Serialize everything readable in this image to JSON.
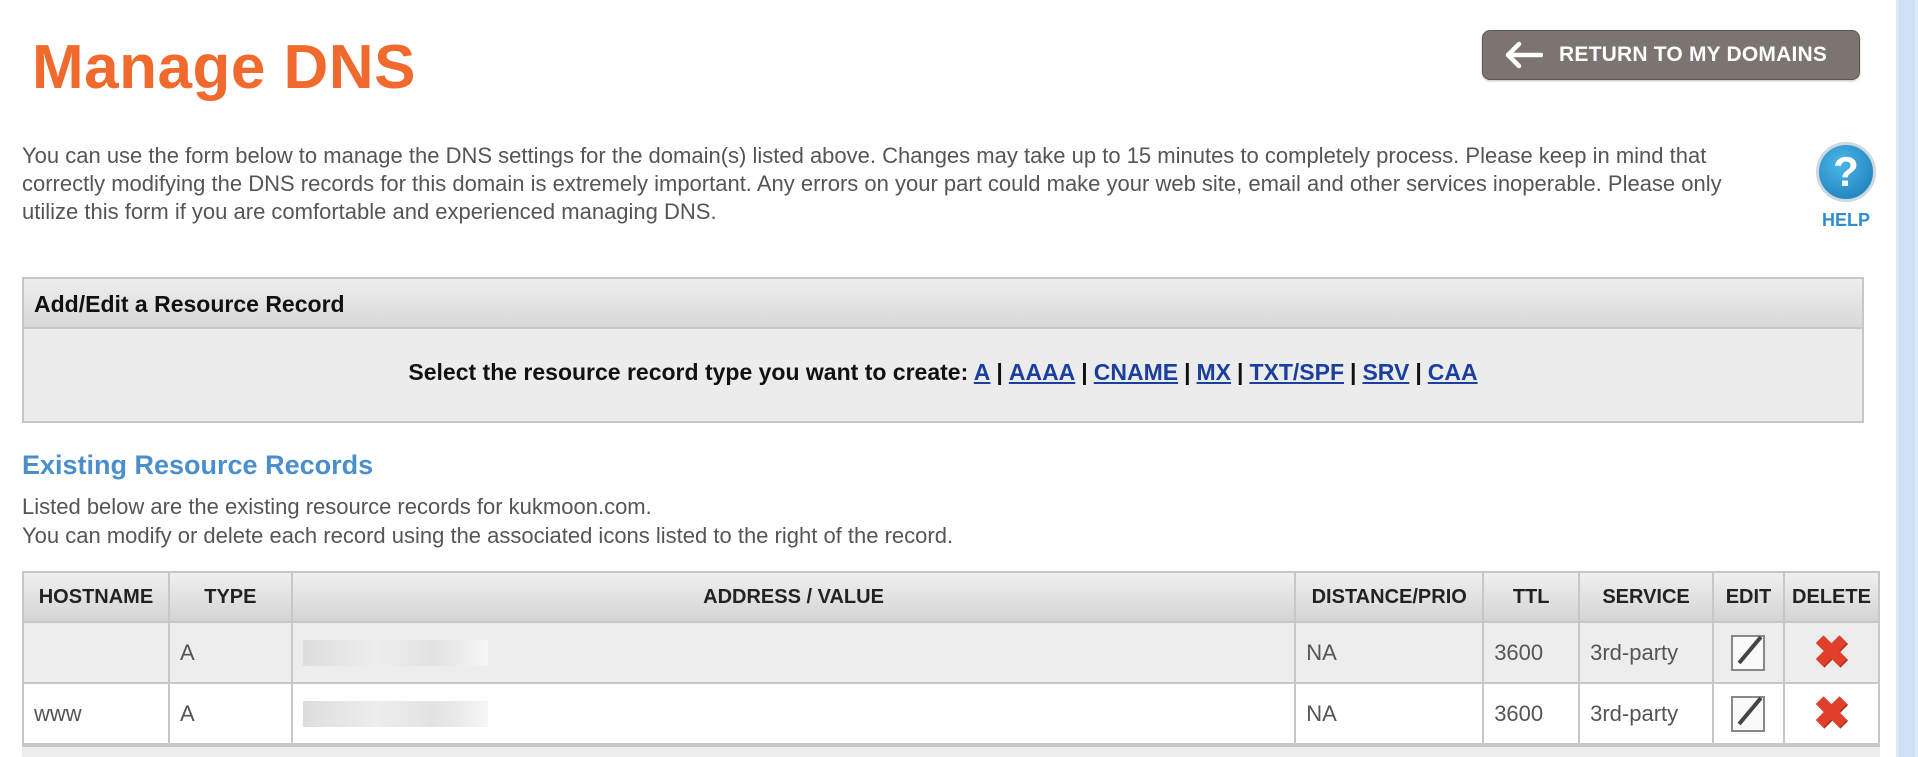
{
  "page": {
    "title": "Manage DNS",
    "return_button": "RETURN TO MY DOMAINS",
    "intro": "You can use the form below to manage the DNS settings for the domain(s) listed above. Changes may take up to 15 minutes to completely process. Please keep in mind that correctly modifying the DNS records for this domain is extremely important. Any errors on your part could make your web site, email and other services inoperable. Please only utilize this form if you are comfortable and experienced managing DNS.",
    "help_label": "HELP",
    "help_icon": "question-mark-icon"
  },
  "add_edit": {
    "title": "Add/Edit a Resource Record",
    "prompt": "Select the resource record type you want to create:",
    "types": [
      "A",
      "AAAA",
      "CNAME",
      "MX",
      "TXT/SPF",
      "SRV",
      "CAA"
    ]
  },
  "existing": {
    "title": "Existing Resource Records",
    "desc_line1": "Listed below are the existing resource records for kukmoon.com.",
    "desc_line2": "You can modify or delete each record using the associated icons listed to the right of the record."
  },
  "table": {
    "headers": [
      "HOSTNAME",
      "TYPE",
      "ADDRESS / VALUE",
      "DISTANCE/PRIO",
      "TTL",
      "SERVICE",
      "EDIT",
      "DELETE"
    ],
    "rows": [
      {
        "hostname": "",
        "type": "A",
        "distance": "NA",
        "ttl": "3600",
        "service": "3rd-party"
      },
      {
        "hostname": "www",
        "type": "A",
        "distance": "NA",
        "ttl": "3600",
        "service": "3rd-party"
      }
    ]
  },
  "colors": {
    "title": "#ef6a2c",
    "link": "#1a3f9c",
    "section_heading": "#4a8fcb",
    "delete_icon": "#e0402a",
    "button_bg": "#7c7471"
  }
}
